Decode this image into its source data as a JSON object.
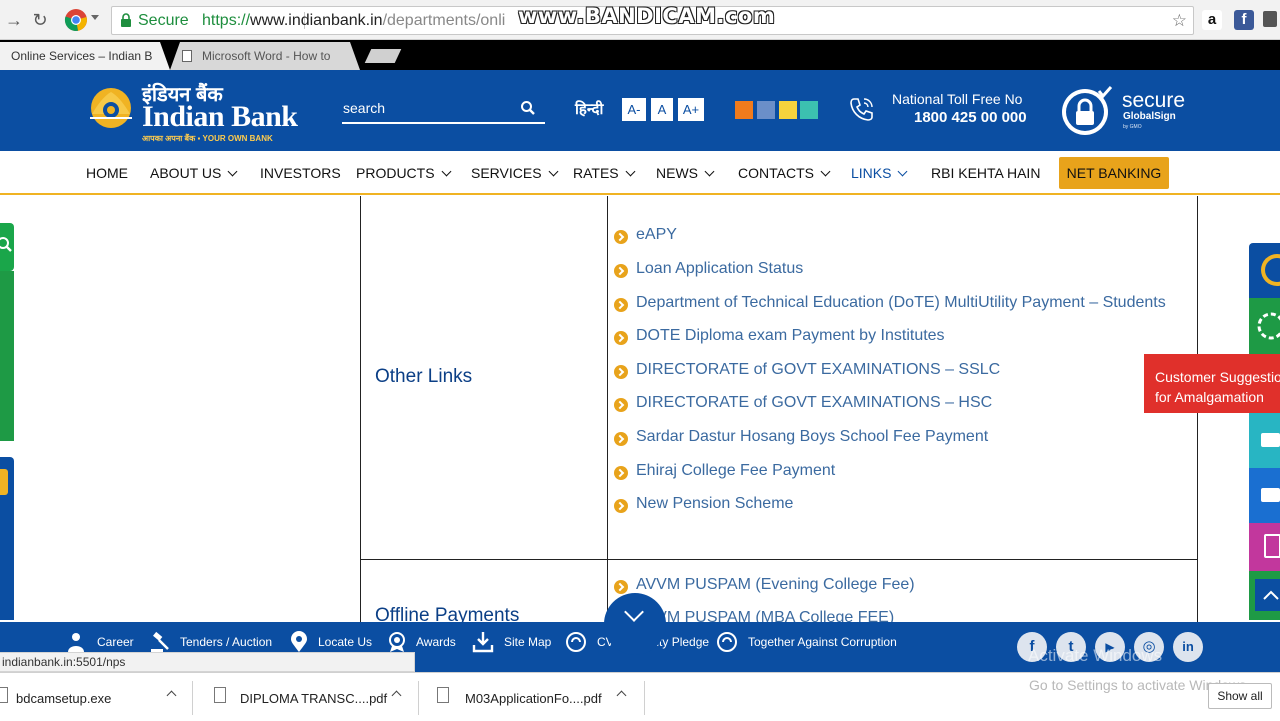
{
  "browser": {
    "secure_label": "Secure",
    "url_scheme": "https://",
    "url_host": "www.indianbank.in",
    "url_path": "/departments/onli",
    "recorder_watermark": "www.BANDICAM.com",
    "tabs": [
      {
        "label": "Online Services – Indian B"
      },
      {
        "label": "Microsoft Word - How to"
      }
    ],
    "ext_amazon": "a",
    "ext_facebook": "f"
  },
  "header": {
    "logo_hindi": "इंडियन बैंक",
    "logo_name": "Indian Bank",
    "logo_tagline": "आपका अपना बैंक  ▪  YOUR OWN BANK",
    "search_placeholder": "search",
    "hindi_link": "हिन्दी",
    "font_sizes": [
      "A-",
      "A",
      "A+"
    ],
    "theme_colors": [
      "#f07b1d",
      "#6b8fc9",
      "#f6d33d",
      "#3cc0b0"
    ],
    "toll_label": "National Toll Free No",
    "toll_number": "1800 425 00 000",
    "secure_word": "secure",
    "secure_sub": "GlobalSign",
    "secure_by": "by GMO"
  },
  "nav": {
    "items": [
      {
        "label": "HOME"
      },
      {
        "label": "ABOUT US"
      },
      {
        "label": "INVESTORS"
      },
      {
        "label": "PRODUCTS"
      },
      {
        "label": "SERVICES"
      },
      {
        "label": "RATES"
      },
      {
        "label": "NEWS"
      },
      {
        "label": "CONTACTS"
      },
      {
        "label": "LINKS"
      },
      {
        "label": "RBI KEHTA HAIN"
      }
    ],
    "net_banking": "NET BANKING",
    "accent": "#f0b323",
    "brand": "#0b4ea2"
  },
  "content": {
    "other_links_title": "Other Links",
    "other_links": [
      "eAPY",
      "Loan Application Status",
      "Department of Technical Education (DoTE) MultiUtility Payment – Students",
      "DOTE Diploma exam Payment by Institutes",
      "DIRECTORATE of GOVT EXAMINATIONS – SSLC",
      "DIRECTORATE of GOVT EXAMINATIONS – HSC",
      "Sardar Dastur Hosang Boys School Fee Payment",
      "Ehiraj College Fee Payment",
      "New Pension Scheme"
    ],
    "offline_title": "Offline Payments",
    "offline_links": [
      "AVVM PUSPAM (Evening College Fee)",
      "AVVM PUSPAM (MBA College FEE)"
    ]
  },
  "widgets": {
    "suggestion_line1": "Customer Suggestion",
    "suggestion_line2": "for Amalgamation"
  },
  "footer": {
    "items": [
      {
        "label": "Career",
        "icon": "person-icon"
      },
      {
        "label": "Tenders / Auction",
        "icon": "gavel-icon"
      },
      {
        "label": "Locate Us",
        "icon": "location-pin-icon"
      },
      {
        "label": "Awards",
        "icon": "award-icon"
      },
      {
        "label": "Site Map",
        "icon": "sitemap-icon"
      },
      {
        "label": "CVC Integrity Pledge",
        "icon": "pledge-icon"
      },
      {
        "label": "Together Against Corruption",
        "icon": "integrity-icon"
      }
    ],
    "social": [
      "f",
      "t",
      "▶",
      "◎",
      "in"
    ],
    "watermark_line1": "Activate Windows",
    "watermark_line2": "Go to Settings to activate Windows."
  },
  "status_url": "indianbank.in:5501/nps",
  "downloads": {
    "items": [
      {
        "name": "bdcamsetup.exe"
      },
      {
        "name": "DIPLOMA TRANSC....pdf"
      },
      {
        "name": "M03ApplicationFo....pdf"
      }
    ],
    "show_all": "Show all"
  }
}
